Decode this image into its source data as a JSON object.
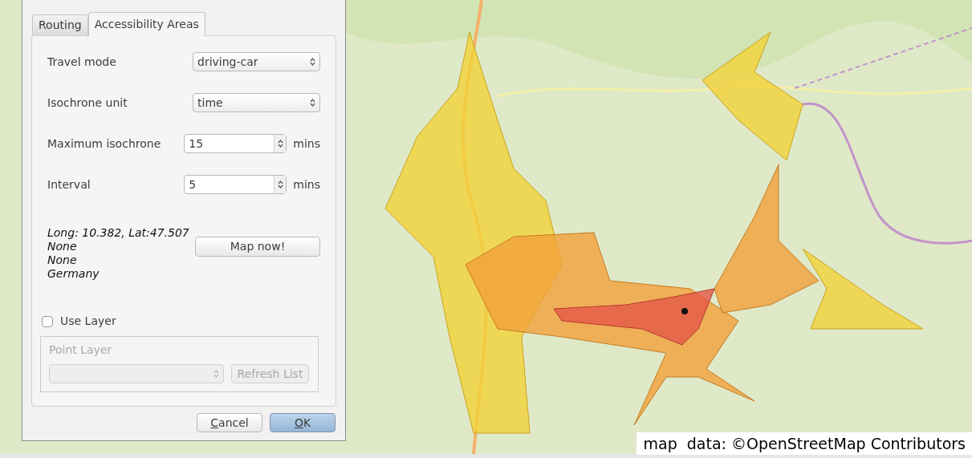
{
  "tabs": [
    {
      "label": "Routing",
      "selected": false
    },
    {
      "label": "Accessibility Areas",
      "selected": true
    }
  ],
  "fields": [
    {
      "kind": "select",
      "label": "Travel mode",
      "value": "driving-car"
    },
    {
      "kind": "select",
      "label": "Isochrone unit",
      "value": "time"
    },
    {
      "kind": "spin",
      "label": "Maximum isochrone",
      "value": "15",
      "unit": "mins"
    },
    {
      "kind": "spin",
      "label": "Interval",
      "value": "5",
      "unit": "mins"
    }
  ],
  "location_lines": [
    "Long: 10.382, Lat:47.507",
    "None",
    "None",
    "Germany"
  ],
  "map_now_button": "Map now!",
  "use_layer": {
    "label": "Use Layer",
    "checked": false
  },
  "point_layer_group": {
    "title": "Point Layer",
    "disabled": true,
    "refresh_button": "Refresh List"
  },
  "buttons": [
    {
      "label": "Cancel",
      "default": false
    },
    {
      "label": "OK",
      "default": true
    }
  ],
  "attribution": "map  data: ©OpenStreetMap Contributors"
}
